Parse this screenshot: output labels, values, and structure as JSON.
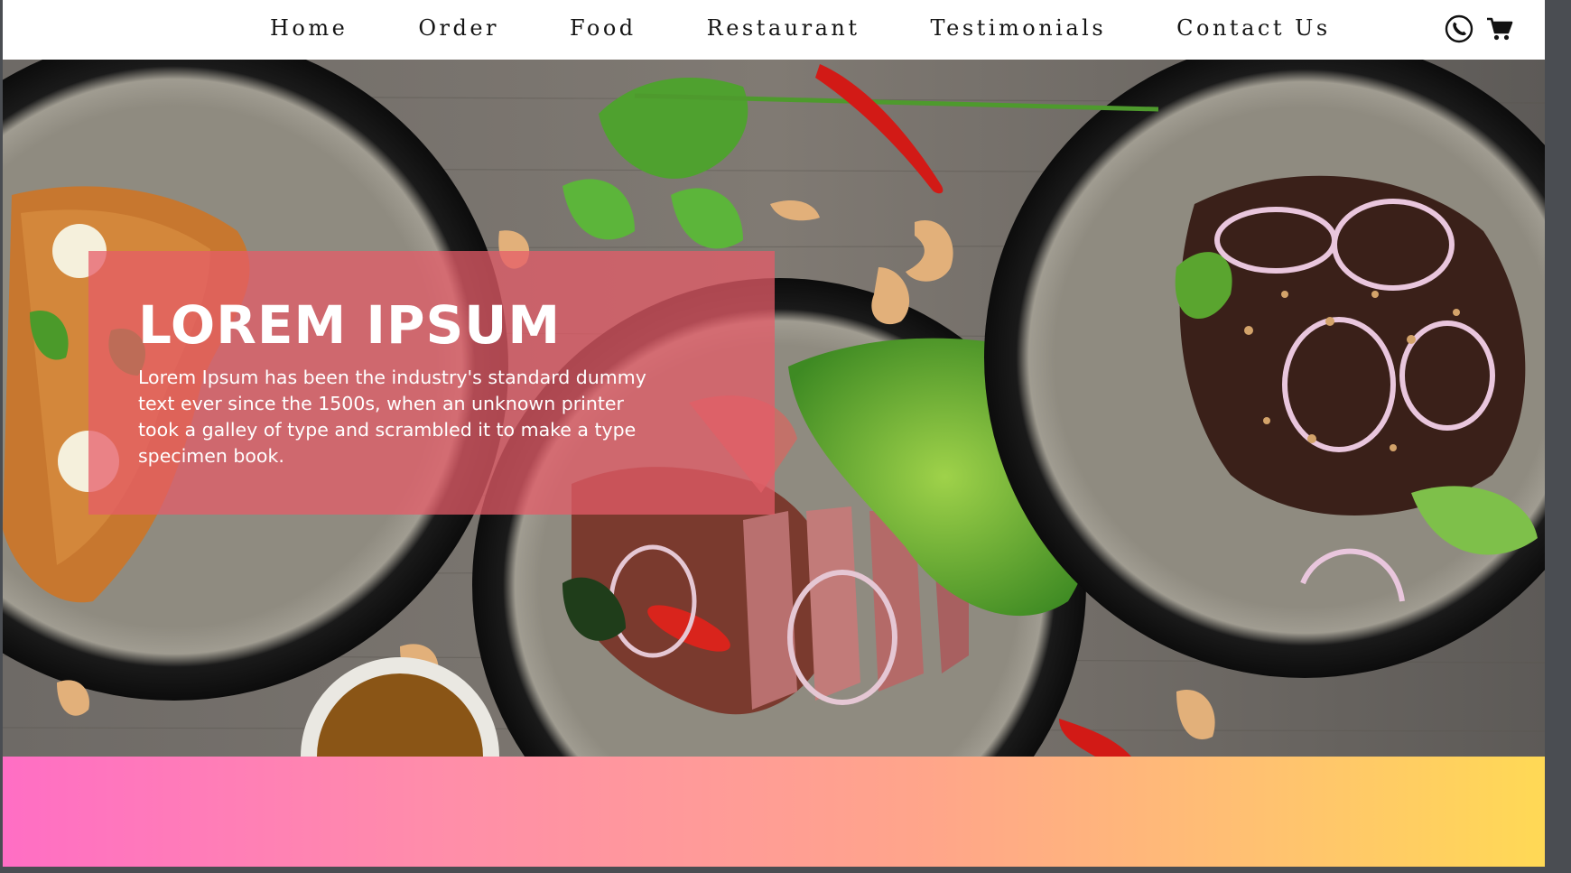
{
  "nav": {
    "links": [
      "Home",
      "Order",
      "Food",
      "Restaurant",
      "Testimonials",
      "Contact Us"
    ],
    "icons": [
      "phone-icon",
      "cart-icon"
    ]
  },
  "hero": {
    "title": "LOREM IPSUM",
    "text": "Lorem Ipsum has been the industry's standard dummy text ever since the 1500s, when an unknown printer took a galley of type and scrambled it to make a type specimen book.",
    "card_color": "#e55c68"
  },
  "strip": {
    "gradient_colors": [
      "#ff6ec4",
      "#ffa58a",
      "#ffd955"
    ]
  }
}
